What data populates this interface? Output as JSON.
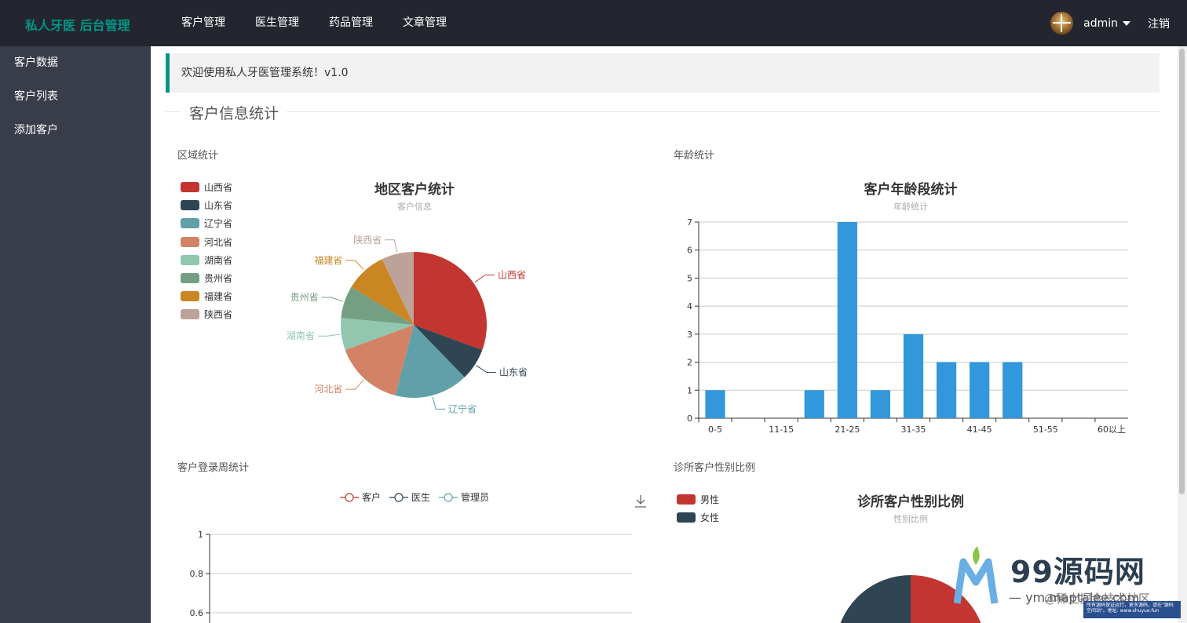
{
  "header": {
    "logo": "私人牙医 后台管理",
    "nav": [
      "客户管理",
      "医生管理",
      "药品管理",
      "文章管理"
    ],
    "user": "admin",
    "logout": "注销"
  },
  "sidebar": {
    "items": [
      {
        "label": "客户数据"
      },
      {
        "label": "客户列表"
      },
      {
        "label": "添加客户"
      }
    ]
  },
  "main": {
    "welcome": "欢迎使用私人牙医管理系统！v1.0",
    "section_title": "客户信息统计",
    "cards": {
      "region": "区域统计",
      "age": "年龄统计",
      "login": "客户登录周统计",
      "gender": "诊所客户性别比例"
    }
  },
  "watermark": {
    "brand": "99源码网",
    "url": "— ym.maptalee.com",
    "overlay": "@稀土掘金技术社区",
    "notice": "所有源码保证运行，更多源码，请在\"源码空间站\"。地址: www.shuyue.fun"
  },
  "colors": {
    "accent": "#009688",
    "header_bg": "#23262e",
    "sidebar_bg": "#393d49",
    "bar": "#3398db"
  },
  "chart_data": [
    {
      "type": "pie",
      "title": "地区客户统计",
      "subtitle": "客户信息",
      "legend_position": "left",
      "slices": [
        {
          "name": "山西省",
          "value": 30,
          "color": "#c23531"
        },
        {
          "name": "山东省",
          "value": 7,
          "color": "#2f4554"
        },
        {
          "name": "辽宁省",
          "value": 16,
          "color": "#61a0a8"
        },
        {
          "name": "河北省",
          "value": 15,
          "color": "#d48265"
        },
        {
          "name": "湖南省",
          "value": 7,
          "color": "#91c7ae"
        },
        {
          "name": "贵州省",
          "value": 7,
          "color": "#749f83"
        },
        {
          "name": "福建省",
          "value": 9,
          "color": "#ca8622"
        },
        {
          "name": "陕西省",
          "value": 7,
          "color": "#bda29a"
        }
      ]
    },
    {
      "type": "bar",
      "title": "客户年龄段统计",
      "subtitle": "年龄统计",
      "categories": [
        "0-5",
        "6-10",
        "11-15",
        "16-20",
        "21-25",
        "26-30",
        "31-35",
        "36-40",
        "41-45",
        "46-50",
        "51-55",
        "56-60",
        "60以上"
      ],
      "values": [
        1,
        0,
        0,
        1,
        7,
        1,
        3,
        2,
        2,
        2,
        0,
        0,
        0
      ],
      "shown_tick_labels": [
        "0-5",
        "11-15",
        "21-25",
        "31-35",
        "41-45",
        "51-55",
        "60以上"
      ],
      "ylim": [
        0,
        7
      ],
      "yticks": [
        0,
        1,
        2,
        3,
        4,
        5,
        6,
        7
      ],
      "grid": true
    },
    {
      "type": "line",
      "series": [
        {
          "name": "客户",
          "color": "#c23531"
        },
        {
          "name": "医生",
          "color": "#2f4554"
        },
        {
          "name": "管理员",
          "color": "#61a0a8"
        }
      ],
      "yticks_visible": [
        "1",
        "0.8",
        "0.6"
      ],
      "legend_position": "top"
    },
    {
      "type": "pie",
      "title": "诊所客户性别比例",
      "subtitle": "性别比例",
      "legend_position": "top-left",
      "slices": [
        {
          "name": "男性",
          "color": "#c23531"
        },
        {
          "name": "女性",
          "color": "#2f4554"
        }
      ]
    }
  ]
}
